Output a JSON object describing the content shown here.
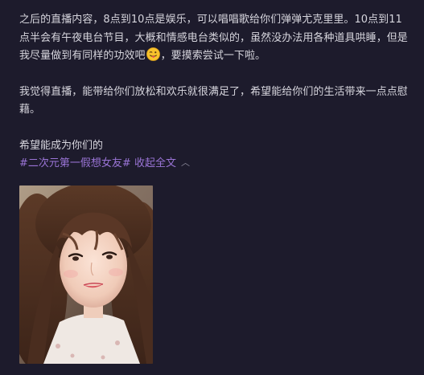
{
  "post": {
    "paragraph1": {
      "before_emoji": "之后的直播内容，8点到10点是娱乐，可以唱唱歌给你们弹弹尤克里里。10点到11点半会有午夜电台节目，大概和情感电台类似的，虽然没办法用各种道具哄睡，但是我尽量做到有同样的功效吧",
      "emoji": "tongue-out-emoji",
      "after_emoji": "，要摸索尝试一下啦。"
    },
    "paragraph2": "我觉得直播，能带给你们放松和欢乐就很满足了，希望能给你们的生活带来一点点慰藉。",
    "wish": "希望能成为你们的",
    "tag": "#二次元第一假想女友#",
    "collapse_label": "收起全文",
    "collapse_icon": "chevron-up-icon",
    "photo": "selfie-photo"
  },
  "colors": {
    "background": "#1d1b2c",
    "text": "#d6d5dd",
    "link": "#9a74d6"
  }
}
